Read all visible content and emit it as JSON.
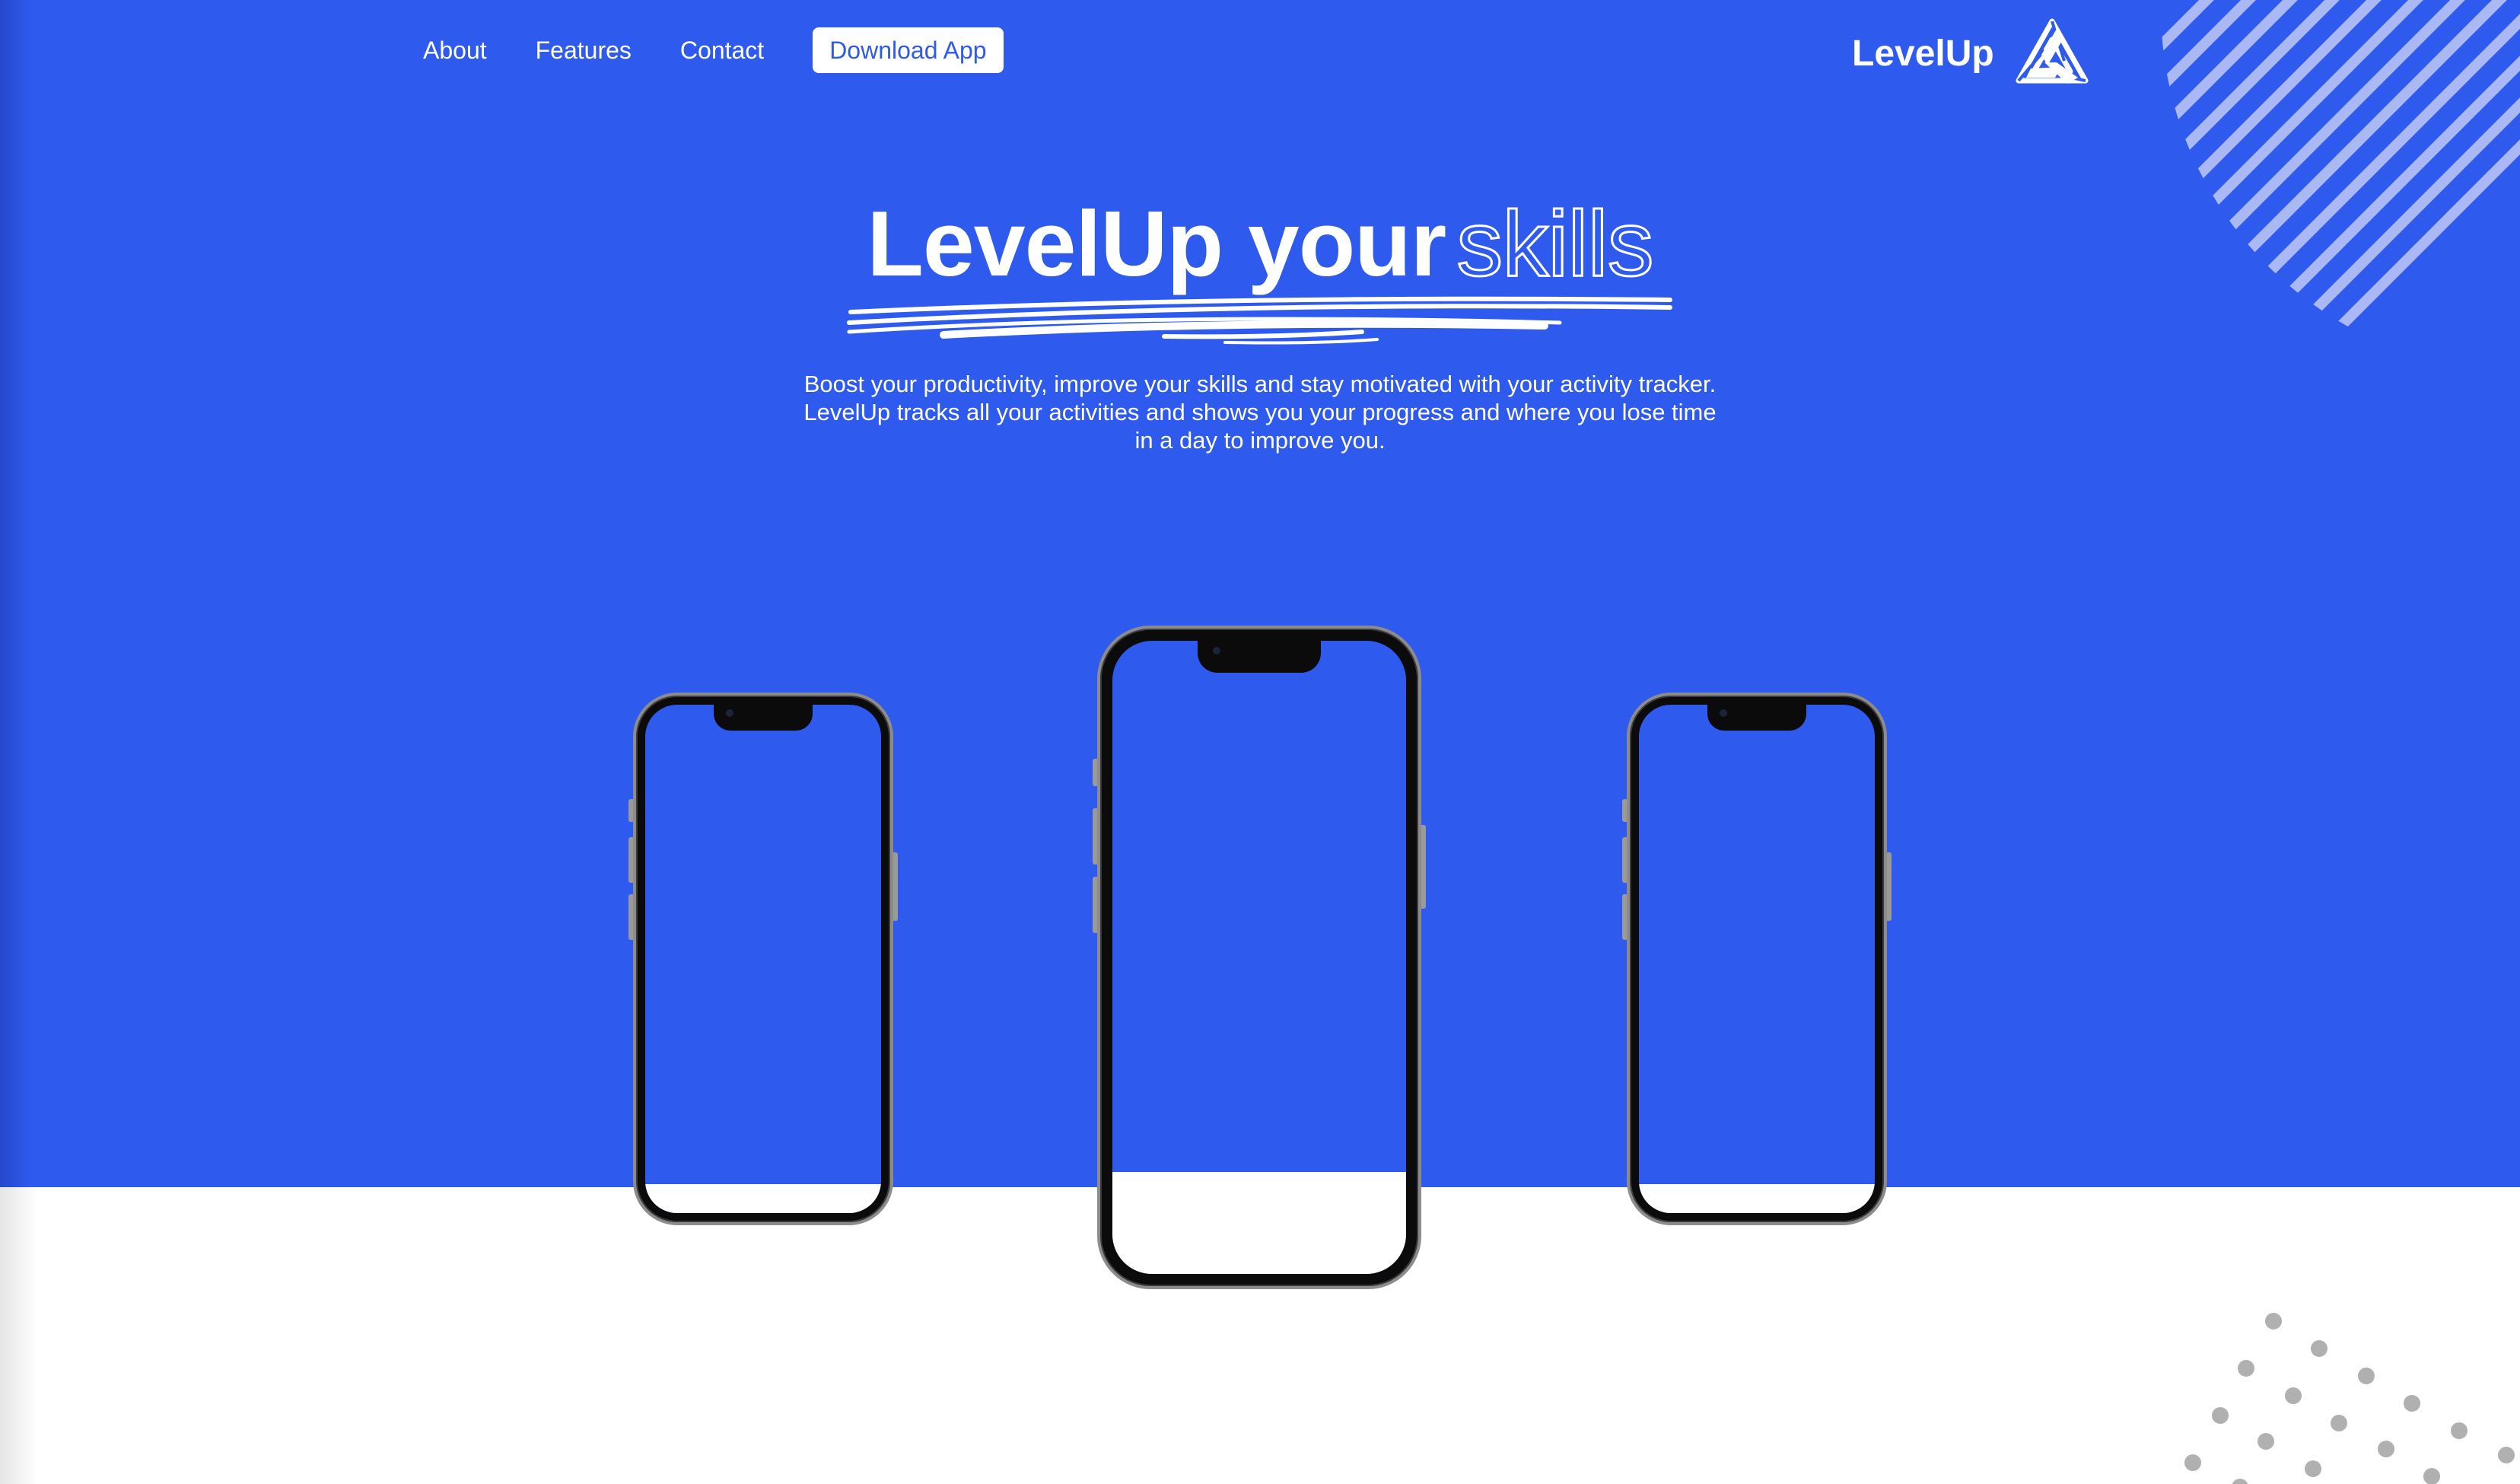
{
  "nav": {
    "links": [
      "About",
      "Features",
      "Contact"
    ],
    "cta_label": "Download App"
  },
  "brand": {
    "name": "LevelUp",
    "logo_icon": "triangle-knot-logo-icon"
  },
  "hero": {
    "headline_solid": "LevelUp your",
    "headline_outline": "skills",
    "subtitle_lines": [
      "Boost your productivity, improve your skills and stay motivated with your activity tracker.",
      "LevelUp tracks all your activities and shows you your progress and where you lose time",
      "in a day to improve you."
    ]
  },
  "colors": {
    "brand_blue": "#2f5aee",
    "white": "#ffffff",
    "dots_gray": "#b0b0b0"
  }
}
